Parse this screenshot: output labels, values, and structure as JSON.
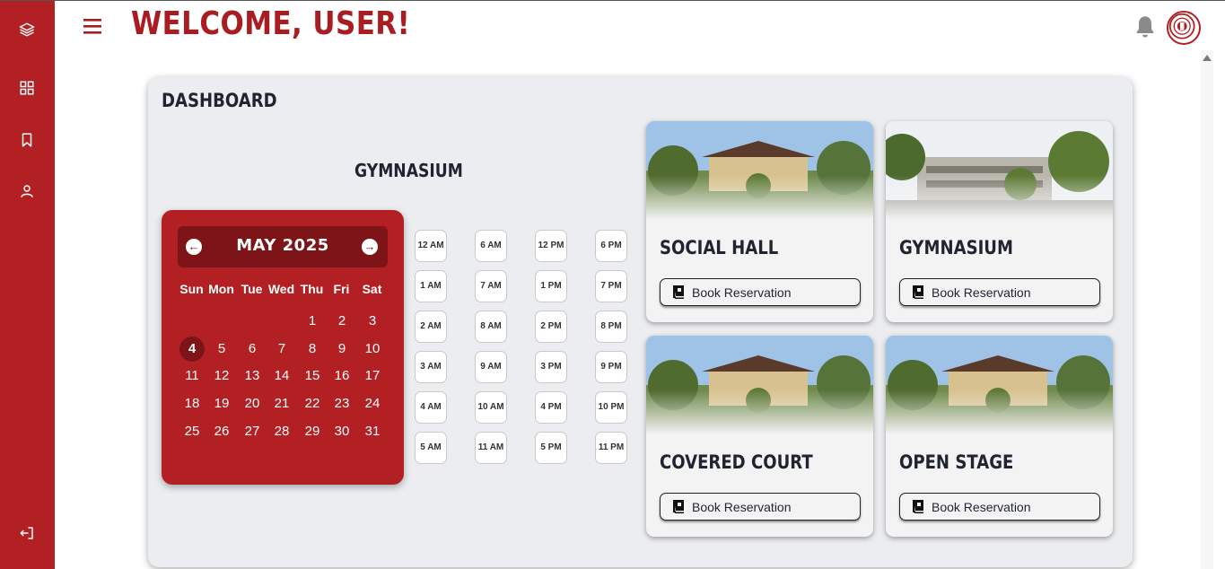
{
  "header": {
    "welcome": "WELCOME, USER!"
  },
  "sidebar": {
    "items": [
      {
        "icon": "layers-icon"
      },
      {
        "icon": "dashboard-grid-icon"
      },
      {
        "icon": "bookmark-icon"
      },
      {
        "icon": "user-icon"
      },
      {
        "icon": "logout-icon"
      }
    ]
  },
  "dashboard": {
    "title": "DASHBOARD",
    "selected_facility": "GYMNASIUM"
  },
  "calendar": {
    "month_label": "MAY 2025",
    "prev_icon": "arrow-left-icon",
    "next_icon": "arrow-right-icon",
    "weekdays": [
      "Sun",
      "Mon",
      "Tue",
      "Wed",
      "Thu",
      "Fri",
      "Sat"
    ],
    "days": [
      "1",
      "2",
      "3",
      "4",
      "5",
      "6",
      "7",
      "8",
      "9",
      "10",
      "11",
      "12",
      "13",
      "14",
      "15",
      "16",
      "17",
      "18",
      "19",
      "20",
      "21",
      "22",
      "23",
      "24",
      "25",
      "26",
      "27",
      "28",
      "29",
      "30",
      "31"
    ],
    "selected_day": "4"
  },
  "time_slots": [
    [
      "12 AM",
      "1 AM",
      "2 AM",
      "3 AM",
      "4 AM",
      "5 AM"
    ],
    [
      "6 AM",
      "7 AM",
      "8 AM",
      "9 AM",
      "10 AM",
      "11 AM"
    ],
    [
      "12 PM",
      "1 PM",
      "2 PM",
      "3 PM",
      "4 PM",
      "5 PM"
    ],
    [
      "6 PM",
      "7 PM",
      "8 PM",
      "9 PM",
      "10 PM",
      "11 PM"
    ]
  ],
  "facilities": [
    {
      "name": "SOCIAL HALL",
      "button": "Book Reservation"
    },
    {
      "name": "GYMNASIUM",
      "button": "Book Reservation"
    },
    {
      "name": "COVERED COURT",
      "button": "Book Reservation"
    },
    {
      "name": "OPEN STAGE",
      "button": "Book Reservation"
    }
  ],
  "colors": {
    "brand_red": "#b22024",
    "dark_red": "#7c1418",
    "panel_bg": "#ebedf0"
  }
}
